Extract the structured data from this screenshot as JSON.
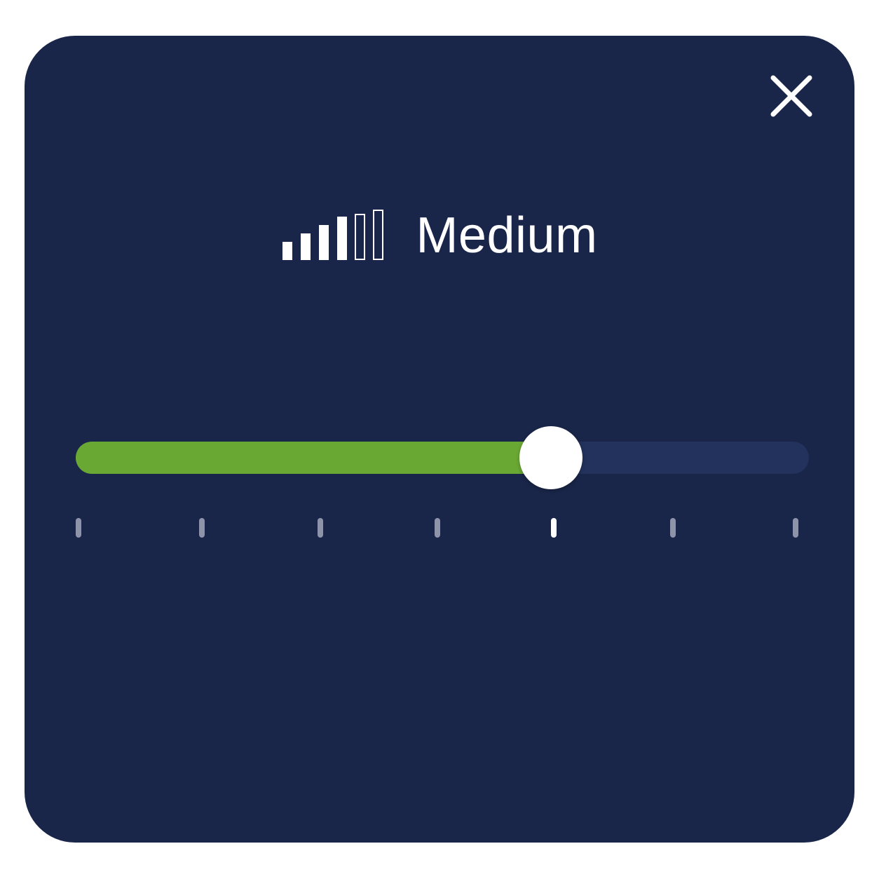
{
  "dialog": {
    "level_label": "Medium",
    "level_icon": "signal-bars-icon",
    "level_bars_filled": 4,
    "level_bars_total": 6,
    "close_icon": "close-icon"
  },
  "slider": {
    "value_fraction": 0.65,
    "ticks_total": 7,
    "active_tick_index": 4,
    "fill_color": "#6aa834",
    "track_color": "#22325c",
    "thumb_color": "#ffffff"
  },
  "colors": {
    "panel_background": "#1a2649",
    "text": "#ffffff",
    "tick_inactive": "#8d94aa",
    "tick_active": "#ffffff"
  }
}
